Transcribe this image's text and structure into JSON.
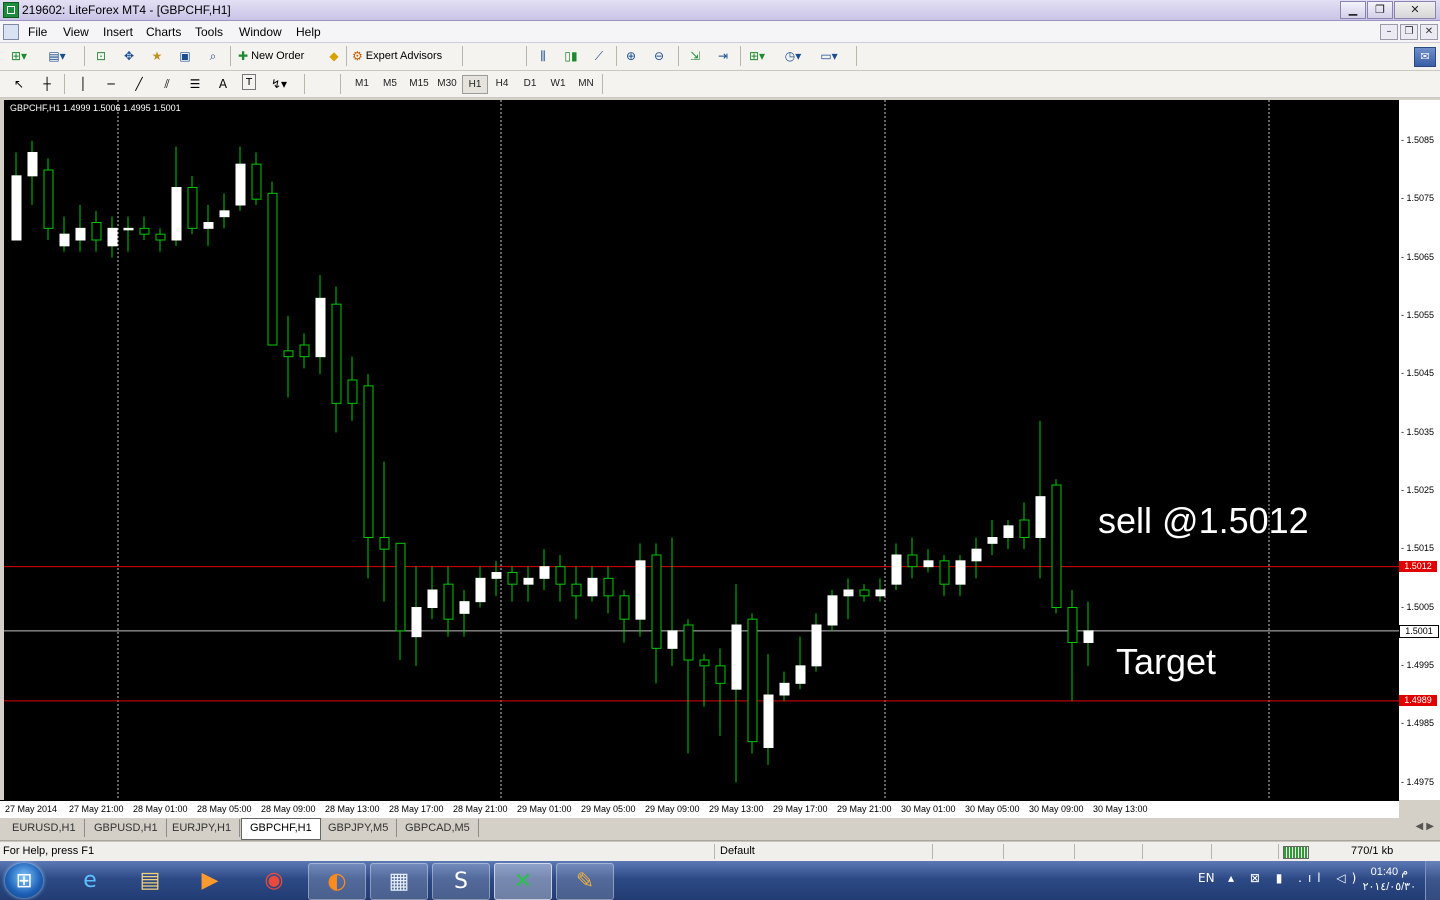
{
  "window": {
    "title": "219602: LiteForex MT4 - [GBPCHF,H1]",
    "minimize": "▁",
    "restore": "❐",
    "close": "✕"
  },
  "menu": {
    "items": [
      "File",
      "View",
      "Insert",
      "Charts",
      "Tools",
      "Window",
      "Help"
    ],
    "mdi": {
      "minimize": "–",
      "restore": "❐",
      "close": "✕"
    }
  },
  "toolbar1": {
    "new_order": "New Order",
    "expert_advisors": "Expert Advisors"
  },
  "toolbar2": {
    "timeframes": [
      "M1",
      "M5",
      "M15",
      "M30",
      "H1",
      "H4",
      "D1",
      "W1",
      "MN"
    ],
    "active_timeframe": "H1",
    "text_tool": "A",
    "label_tool": "T"
  },
  "chart": {
    "symbol_info": "GBPCHF,H1  1.4999 1.5006 1.4995 1.5001",
    "annotation_sell": "sell @1.5012",
    "annotation_target": "Target",
    "colors": {
      "background": "#000000",
      "bull": "#ffffff",
      "wick": "#00c800",
      "level": "#e00000",
      "bid": "#c0c0c0"
    }
  },
  "chart_data": {
    "type": "candlestick",
    "symbol": "GBPCHF",
    "timeframe": "H1",
    "ylim": [
      1.4972,
      1.5092
    ],
    "price_ticks": [
      "1.5085",
      "1.5075",
      "1.5065",
      "1.5055",
      "1.5045",
      "1.5035",
      "1.5025",
      "1.5015",
      "1.5005",
      "1.4995",
      "1.4985",
      "1.4975"
    ],
    "price_tick_values": [
      1.5085,
      1.5075,
      1.5065,
      1.5055,
      1.5045,
      1.5035,
      1.5025,
      1.5015,
      1.5005,
      1.4995,
      1.4985,
      1.4975
    ],
    "time_ticks": [
      "27 May 2014",
      "27 May 21:00",
      "28 May 01:00",
      "28 May 05:00",
      "28 May 09:00",
      "28 May 13:00",
      "28 May 17:00",
      "28 May 21:00",
      "29 May 01:00",
      "29 May 05:00",
      "29 May 09:00",
      "29 May 13:00",
      "29 May 17:00",
      "29 May 21:00",
      "30 May 01:00",
      "30 May 05:00",
      "30 May 09:00",
      "30 May 13:00"
    ],
    "levels": [
      {
        "label": "1.5012",
        "price": 1.5012,
        "color": "#e00000"
      },
      {
        "label": "1.5001",
        "price": 1.5001,
        "color": "#c0c0c0"
      },
      {
        "label": "1.4989",
        "price": 1.4989,
        "color": "#e00000"
      }
    ],
    "candles": [
      [
        1.5068,
        1.5079,
        1.5068,
        1.5083
      ],
      [
        1.5079,
        1.5083,
        1.5074,
        1.5085
      ],
      [
        1.508,
        1.507,
        1.5068,
        1.5082
      ],
      [
        1.5067,
        1.5069,
        1.5066,
        1.5072
      ],
      [
        1.5068,
        1.507,
        1.5066,
        1.5074
      ],
      [
        1.5071,
        1.5068,
        1.5066,
        1.5073
      ],
      [
        1.5067,
        1.507,
        1.5065,
        1.5072
      ],
      [
        1.507,
        1.507,
        1.5066,
        1.5072
      ],
      [
        1.507,
        1.5069,
        1.5068,
        1.5072
      ],
      [
        1.5069,
        1.5068,
        1.5066,
        1.507
      ],
      [
        1.5068,
        1.5077,
        1.5067,
        1.5084
      ],
      [
        1.5077,
        1.507,
        1.5069,
        1.5079
      ],
      [
        1.507,
        1.5071,
        1.5067,
        1.5074
      ],
      [
        1.5072,
        1.5073,
        1.507,
        1.5076
      ],
      [
        1.5074,
        1.5081,
        1.5073,
        1.5084
      ],
      [
        1.5081,
        1.5075,
        1.5074,
        1.5083
      ],
      [
        1.5076,
        1.505,
        1.505,
        1.5078
      ],
      [
        1.5049,
        1.5048,
        1.5041,
        1.5055
      ],
      [
        1.505,
        1.5048,
        1.5046,
        1.5052
      ],
      [
        1.5048,
        1.5058,
        1.5045,
        1.5062
      ],
      [
        1.5057,
        1.504,
        1.5035,
        1.506
      ],
      [
        1.5044,
        1.504,
        1.5037,
        1.5048
      ],
      [
        1.5043,
        1.5017,
        1.501,
        1.5045
      ],
      [
        1.5017,
        1.5015,
        1.5006,
        1.503
      ],
      [
        1.5016,
        1.5001,
        1.4996,
        1.5016
      ],
      [
        1.5,
        1.5005,
        1.4995,
        1.5012
      ],
      [
        1.5005,
        1.5008,
        1.5003,
        1.5012
      ],
      [
        1.5009,
        1.5003,
        1.5,
        1.5012
      ],
      [
        1.5004,
        1.5006,
        1.5,
        1.5008
      ],
      [
        1.5006,
        1.501,
        1.5005,
        1.5012
      ],
      [
        1.501,
        1.5011,
        1.5007,
        1.5013
      ],
      [
        1.5011,
        1.5009,
        1.5006,
        1.5012
      ],
      [
        1.5009,
        1.501,
        1.5006,
        1.5012
      ],
      [
        1.501,
        1.5012,
        1.5008,
        1.5015
      ],
      [
        1.5012,
        1.5009,
        1.5006,
        1.5014
      ],
      [
        1.5009,
        1.5007,
        1.5003,
        1.5012
      ],
      [
        1.5007,
        1.501,
        1.5006,
        1.5012
      ],
      [
        1.501,
        1.5007,
        1.5004,
        1.5012
      ],
      [
        1.5007,
        1.5003,
        1.4999,
        1.5008
      ],
      [
        1.5003,
        1.5013,
        1.5,
        1.5016
      ],
      [
        1.5014,
        1.4998,
        1.4992,
        1.5016
      ],
      [
        1.4998,
        1.5001,
        1.4995,
        1.5017
      ],
      [
        1.5002,
        1.4996,
        1.498,
        1.5003
      ],
      [
        1.4996,
        1.4995,
        1.4988,
        1.4997
      ],
      [
        1.4995,
        1.4992,
        1.4983,
        1.4998
      ],
      [
        1.4991,
        1.5002,
        1.4975,
        1.5009
      ],
      [
        1.5003,
        1.4982,
        1.498,
        1.5004
      ],
      [
        1.4981,
        1.499,
        1.4978,
        1.4997
      ],
      [
        1.499,
        1.4992,
        1.4989,
        1.4994
      ],
      [
        1.4992,
        1.4995,
        1.4991,
        1.5
      ],
      [
        1.4995,
        1.5002,
        1.4994,
        1.5004
      ],
      [
        1.5002,
        1.5007,
        1.5001,
        1.5008
      ],
      [
        1.5007,
        1.5008,
        1.5003,
        1.501
      ],
      [
        1.5008,
        1.5007,
        1.5006,
        1.5009
      ],
      [
        1.5007,
        1.5008,
        1.5006,
        1.501
      ],
      [
        1.5009,
        1.5014,
        1.5008,
        1.5016
      ],
      [
        1.5014,
        1.5012,
        1.501,
        1.5017
      ],
      [
        1.5012,
        1.5013,
        1.5011,
        1.5015
      ],
      [
        1.5013,
        1.5009,
        1.5007,
        1.5014
      ],
      [
        1.5009,
        1.5013,
        1.5007,
        1.5014
      ],
      [
        1.5013,
        1.5015,
        1.501,
        1.5017
      ],
      [
        1.5016,
        1.5017,
        1.5014,
        1.502
      ],
      [
        1.5017,
        1.5019,
        1.5015,
        1.502
      ],
      [
        1.502,
        1.5017,
        1.5015,
        1.5023
      ],
      [
        1.5017,
        1.5024,
        1.501,
        1.5037
      ],
      [
        1.5026,
        1.5005,
        1.5004,
        1.5027
      ],
      [
        1.5005,
        1.4999,
        1.4989,
        1.5008
      ],
      [
        1.4999,
        1.5001,
        1.4995,
        1.5006
      ]
    ]
  },
  "tabs": {
    "items": [
      "EURUSD,H1",
      "GBPUSD,H1",
      "EURJPY,H1",
      "GBPCHF,H1",
      "GBPJPY,M5",
      "GBPCAD,M5"
    ],
    "active": "GBPCHF,H1",
    "arrows": "◀ ▶"
  },
  "status": {
    "help": "For Help, press F1",
    "profile": "Default",
    "traffic": "770/1 kb"
  },
  "taskbar": {
    "start": "⊞",
    "apps": [
      {
        "icon": "e",
        "color": "#5cc0ff"
      },
      {
        "icon": "▤",
        "color": "#f2d27a"
      },
      {
        "icon": "▶",
        "color": "#ff9a2e"
      },
      {
        "icon": "◉",
        "color": "#e84a3c"
      },
      {
        "icon": "◐",
        "color": "#ff8a1e"
      },
      {
        "icon": "▦",
        "color": "#e6eef8"
      },
      {
        "icon": "S",
        "color": "#ffffff"
      },
      {
        "icon": "✕",
        "color": "#2bc04a"
      },
      {
        "icon": "✎",
        "color": "#f0b040"
      }
    ],
    "lang": "EN",
    "tray_icons": "▴ ⊠ ▮ .ıl ◁)",
    "time": "01:40 م",
    "date": "٢٠١٤/٠٥/٣٠"
  }
}
